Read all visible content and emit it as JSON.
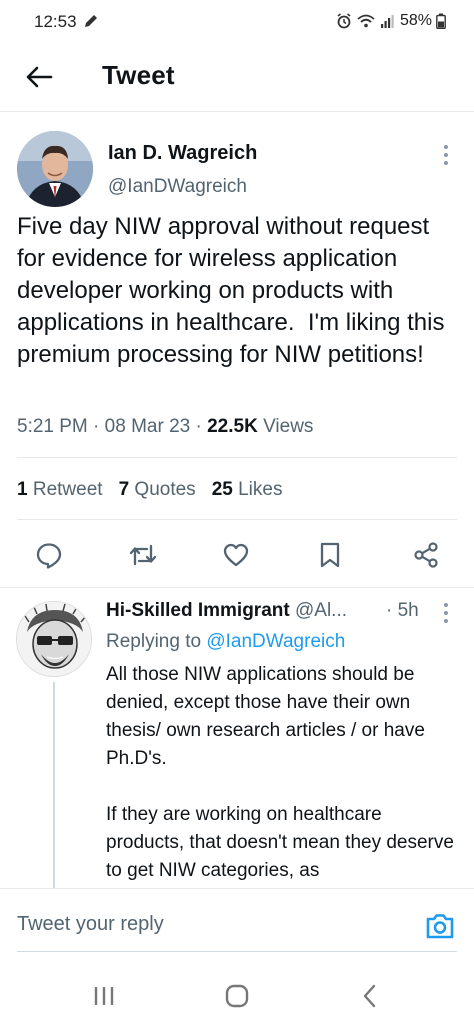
{
  "status_bar": {
    "time": "12:53",
    "battery": "58%"
  },
  "header": {
    "title": "Tweet"
  },
  "main_tweet": {
    "author_name": "Ian D. Wagreich",
    "author_handle": "@IanDWagreich",
    "text": "Five day NIW approval without request for evidence for wireless application developer working on products with applications in healthcare.  I'm liking this premium processing for NIW petitions!",
    "time": "5:21 PM",
    "date": "08 Mar 23",
    "views_count": "22.5K",
    "views_label": "Views",
    "retweets_count": "1",
    "retweets_label": "Retweet",
    "quotes_count": "7",
    "quotes_label": "Quotes",
    "likes_count": "25",
    "likes_label": "Likes"
  },
  "reply": {
    "author_name": "Hi-Skilled Immigrant",
    "author_handle": "@Al...",
    "time": "5h",
    "replying_to_label": "Replying to",
    "replying_to_handle": "@IanDWagreich",
    "text": "All those NIW applications should be denied, except those have their own thesis/ own research articles / or have Ph.D's.\n\nIf they are working on healthcare products, that doesn't mean they deserve to get NIW categories, as"
  },
  "composer": {
    "placeholder": "Tweet your reply"
  },
  "colors": {
    "accent": "#1d9bf0",
    "secondary_text": "#536471",
    "primary_text": "#0f1419"
  },
  "icons": {
    "back": "arrow-left-icon",
    "more": "more-vertical-icon",
    "reply": "reply-icon",
    "retweet": "retweet-icon",
    "like": "heart-icon",
    "bookmark": "bookmark-icon",
    "share": "share-icon",
    "camera": "camera-icon"
  }
}
